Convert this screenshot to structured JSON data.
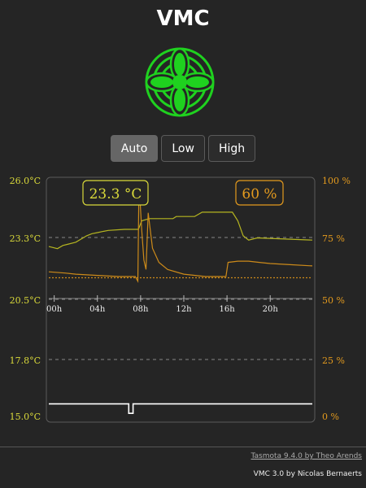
{
  "app": {
    "title": "VMC"
  },
  "fan_icon": {
    "name": "fan-icon",
    "color": "#1fd11f"
  },
  "modes": {
    "buttons": [
      {
        "label": "Auto",
        "active": true
      },
      {
        "label": "Low",
        "active": false
      },
      {
        "label": "High",
        "active": false
      }
    ]
  },
  "readouts": {
    "temperature": "23.3 °C",
    "humidity": "60 %"
  },
  "colors": {
    "temperature": "#d9d93a",
    "temperature_line": "#b5b520",
    "humidity": "#e39a1e",
    "humidity_line": "#cc8a1a",
    "fan_speed": "#ffffff",
    "grid": "#888888",
    "axis": "#5a5a5a"
  },
  "chart_data": {
    "type": "line",
    "left_axis": {
      "ticks": [
        "26.0°C",
        "23.3°C",
        "20.5°C",
        "17.8°C",
        "15.0°C"
      ],
      "range": [
        15.0,
        26.0
      ]
    },
    "right_axis": {
      "ticks": [
        "100 %",
        "75 %",
        "50 %",
        "25 %",
        "0 %"
      ],
      "range": [
        0,
        100
      ]
    },
    "x_ticks": [
      "00h",
      "04h",
      "08h",
      "12h",
      "16h",
      "20h"
    ],
    "x_range": [
      -0.5,
      23.9
    ],
    "x_tick_hours": [
      0,
      4,
      8,
      12,
      16,
      20
    ],
    "series": [
      {
        "axis": "left",
        "color_key": "temperature_line",
        "points": [
          [
            -0.5,
            23.0
          ],
          [
            0.3,
            22.9
          ],
          [
            0.8,
            23.05
          ],
          [
            1.2,
            23.1
          ],
          [
            2,
            23.2
          ],
          [
            3,
            23.5
          ],
          [
            3.5,
            23.6
          ],
          [
            4,
            23.65
          ],
          [
            4.5,
            23.7
          ],
          [
            5,
            23.75
          ],
          [
            6.5,
            23.8
          ],
          [
            7.8,
            23.8
          ],
          [
            8.1,
            24.2
          ],
          [
            8.8,
            24.3
          ],
          [
            11,
            24.3
          ],
          [
            11.3,
            24.4
          ],
          [
            13,
            24.4
          ],
          [
            13.7,
            24.6
          ],
          [
            15,
            24.6
          ],
          [
            16.5,
            24.6
          ],
          [
            17,
            24.2
          ],
          [
            17.5,
            23.5
          ],
          [
            18,
            23.3
          ],
          [
            18.8,
            23.4
          ],
          [
            23.9,
            23.3
          ]
        ]
      },
      {
        "axis": "right",
        "color_key": "humidity_line",
        "points": [
          [
            -0.5,
            62
          ],
          [
            1,
            61.5
          ],
          [
            2,
            61
          ],
          [
            4,
            60.5
          ],
          [
            6,
            60
          ],
          [
            7.5,
            60
          ],
          [
            7.75,
            58
          ],
          [
            7.85,
            100
          ],
          [
            8.1,
            80
          ],
          [
            8.3,
            67
          ],
          [
            8.5,
            63
          ],
          [
            8.7,
            87
          ],
          [
            9.1,
            72
          ],
          [
            9.7,
            66
          ],
          [
            10.5,
            63
          ],
          [
            12,
            61
          ],
          [
            14,
            60
          ],
          [
            15.9,
            60
          ],
          [
            16.1,
            66
          ],
          [
            17,
            66.5
          ],
          [
            18,
            66.5
          ],
          [
            19,
            66
          ],
          [
            20,
            65.5
          ],
          [
            22,
            65
          ],
          [
            23.9,
            64.5
          ]
        ]
      },
      {
        "axis": "right",
        "color_key": "humidity_line",
        "points": [
          [
            -0.5,
            59.5
          ],
          [
            23.9,
            59.5
          ]
        ],
        "dotted": true
      },
      {
        "axis": "right",
        "color_key": "fan_speed",
        "points": [
          [
            -0.5,
            6
          ],
          [
            6.9,
            6
          ],
          [
            6.9,
            2
          ],
          [
            7.3,
            2
          ],
          [
            7.3,
            6
          ],
          [
            23.9,
            6
          ]
        ]
      }
    ],
    "grid": true
  },
  "footer": {
    "tasmota_credit": "Tasmota 9.4.0 by Theo Arends",
    "vmc_credit": "VMC 3.0 by Nicolas Bernaerts"
  }
}
